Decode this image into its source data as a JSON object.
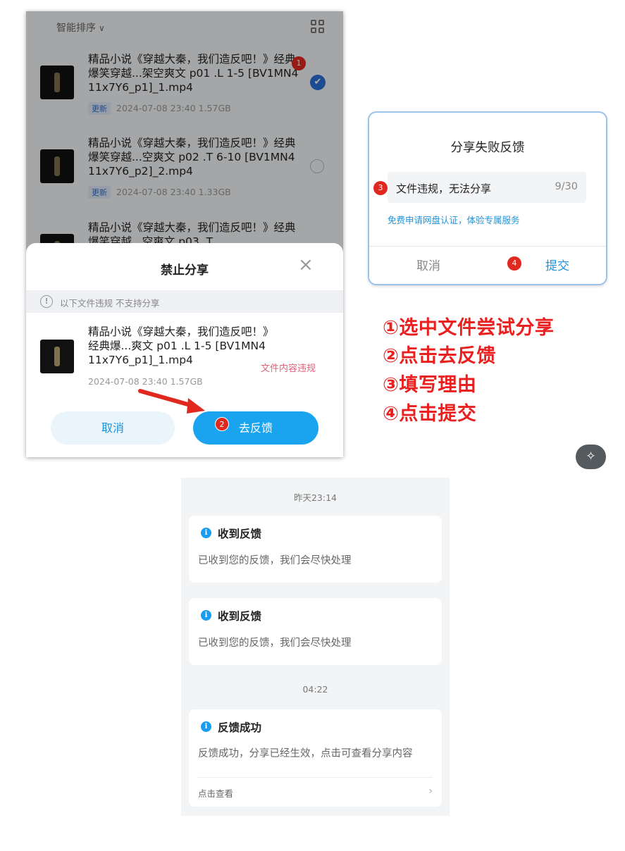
{
  "panel1": {
    "sort_label": "智能排序",
    "files": [
      {
        "name": "精品小说《穿越大秦，我们造反吧！》经典爆笑穿越...架空爽文 p01 .L 1-5 [BV1MN411x7Y6_p1]_1.mp4",
        "badge": "更新",
        "date": "2024-07-08  23:40",
        "size": "1.57GB",
        "selected": true,
        "step": "1"
      },
      {
        "name": "精品小说《穿越大秦，我们造反吧！》经典爆笑穿越...空爽文 p02 .T 6-10 [BV1MN411x7Y6_p2]_2.mp4",
        "badge": "更新",
        "date": "2024-07-08  23:40",
        "size": "1.33GB",
        "selected": false
      },
      {
        "name": "精品小说《穿越大秦，我们造反吧！》经典爆笑穿越...空爽文 p03 .T",
        "badge": "",
        "date": "",
        "size": "",
        "selected": false
      }
    ],
    "modal": {
      "title": "禁止分享",
      "close": "×",
      "notice": "以下文件违规 不支持分享",
      "file_name": "精品小说《穿越大秦，我们造反吧！》经典爆...爽文 p01 .L 1-5 [BV1MN411x7Y6_p1]_1.mp4",
      "file_meta": "2024-07-08  23:40  1.57GB",
      "violation": "文件内容违规",
      "cancel": "取消",
      "feedback": "去反馈",
      "step": "2"
    }
  },
  "panel2": {
    "title": "分享失败反馈",
    "input_value": "文件违规，无法分享",
    "count": "9/30",
    "link": "免费申请网盘认证，体验专属服务",
    "cancel": "取消",
    "submit": "提交",
    "step_input": "3",
    "step_submit": "4"
  },
  "instructions": [
    "①选中文件尝试分享",
    "②点击去反馈",
    "③填写理由",
    "④点击提交"
  ],
  "messages": {
    "ts1": "昨天23:14",
    "ts2": "04:22",
    "cards": [
      {
        "title": "收到反馈",
        "body": "已收到您的反馈，我们会尽快处理"
      },
      {
        "title": "收到反馈",
        "body": "已收到您的反馈，我们会尽快处理"
      },
      {
        "title": "反馈成功",
        "body": "反馈成功，分享已经生效，点击可查看分享内容",
        "link": "点击查看"
      }
    ]
  },
  "colors": {
    "accent": "#1aa3ef",
    "step_red": "#e0281f",
    "instruction_red": "#e8201f",
    "violation_pink": "#e0607a"
  },
  "icons": {
    "sort_chevron": "chevron-down-icon",
    "grid": "grid-icon",
    "close": "close-icon",
    "notice": "exclamation-circle-icon",
    "info": "info-icon",
    "chevron_right": "chevron-right-icon",
    "magic": "magic-wand-icon",
    "check": "checkmark-icon",
    "arrow": "red-arrow-icon"
  }
}
